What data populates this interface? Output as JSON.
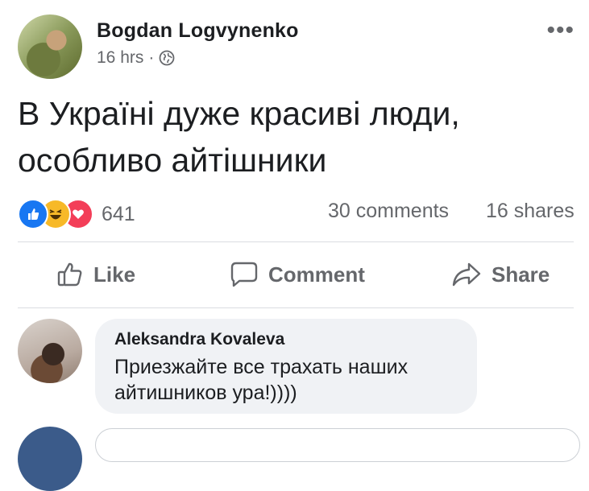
{
  "post": {
    "author": "Bogdan Logvynenko",
    "time": "16 hrs",
    "separator": "·",
    "more": "•••",
    "text_line1": "В Україні дуже красиві люди,",
    "text_line2": "особливо айтішники"
  },
  "stats": {
    "reaction_count": "641",
    "comments": "30 comments",
    "shares": "16 shares"
  },
  "actions": {
    "like": "Like",
    "comment": "Comment",
    "share": "Share"
  },
  "comment": {
    "author": "Aleksandra Kovaleva",
    "text": "Приезжайте все трахать наших айтишников ура!))))"
  },
  "colors": {
    "like_blue": "#1877f2",
    "love_red": "#f33e58",
    "haha_yellow": "#f7b928",
    "secondary_text": "#65676b"
  }
}
